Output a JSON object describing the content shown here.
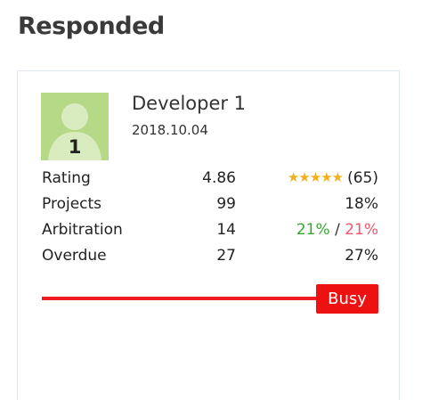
{
  "section": {
    "title": "Responded"
  },
  "developer": {
    "avatar_number": "1",
    "name": "Developer 1",
    "date": "2018.10.04",
    "avatar_color": "#b6d987"
  },
  "stats": {
    "rating": {
      "label": "Rating",
      "value": "4.86",
      "stars_filled": 5,
      "stars_max": 5,
      "stars_glyphs": "★★★★★",
      "reviews": "(65)"
    },
    "projects": {
      "label": "Projects",
      "value": "99",
      "percent": "18%"
    },
    "arbitration": {
      "label": "Arbitration",
      "value": "14",
      "percent_good": "21%",
      "separator": "/",
      "percent_bad": "21%"
    },
    "overdue": {
      "label": "Overdue",
      "value": "27",
      "percent": "27%"
    }
  },
  "status": {
    "label": "Busy",
    "color": "#ee1111"
  },
  "colors": {
    "star": "#f2b01e",
    "good": "#3aa335",
    "bad": "#f0596b"
  }
}
